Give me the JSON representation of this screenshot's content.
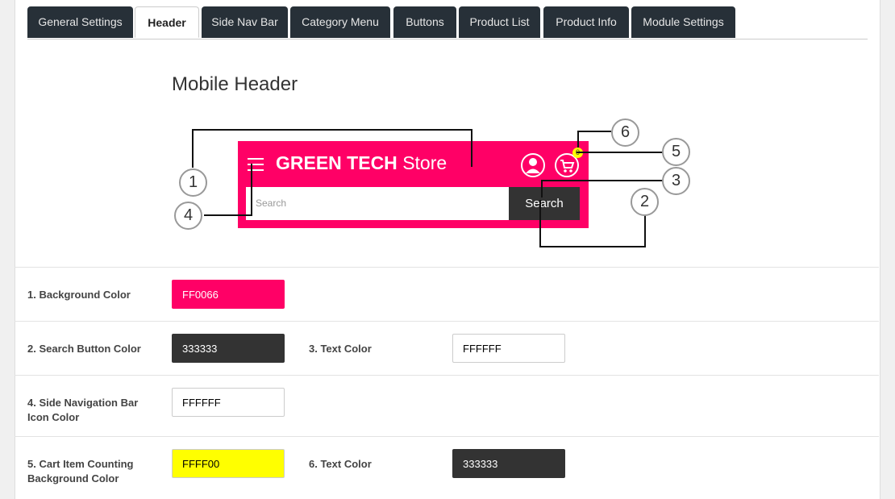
{
  "tabs": [
    {
      "label": "General Settings",
      "active": false
    },
    {
      "label": "Header",
      "active": true
    },
    {
      "label": "Side Nav Bar",
      "active": false
    },
    {
      "label": "Category Menu",
      "active": false
    },
    {
      "label": "Buttons",
      "active": false
    },
    {
      "label": "Product List",
      "active": false
    },
    {
      "label": "Product Info",
      "active": false
    },
    {
      "label": "Module Settings",
      "active": false
    }
  ],
  "section": {
    "title": "Mobile Header"
  },
  "preview": {
    "brand_bold": "GREEN TECH",
    "brand_light": "Store",
    "search_placeholder": "Search",
    "search_button": "Search",
    "cart_count": "0",
    "callouts": [
      "1",
      "2",
      "3",
      "4",
      "5",
      "6"
    ]
  },
  "fields": [
    {
      "label": "1. Background Color",
      "value": "FF0066",
      "bg": "#ff0066",
      "fg": "#ffffff"
    },
    {
      "label": "2. Search Button Color",
      "value": "333333",
      "bg": "#333333",
      "fg": "#ffffff"
    },
    {
      "label": "3. Text Color",
      "value": "FFFFFF",
      "bg": "#ffffff",
      "fg": "#000000"
    },
    {
      "label": "4. Side Navigation Bar Icon Color",
      "value": "FFFFFF",
      "bg": "#ffffff",
      "fg": "#000000"
    },
    {
      "label": "5. Cart Item Counting Background Color",
      "value": "FFFF00",
      "bg": "#ffff00",
      "fg": "#000000"
    },
    {
      "label": "6. Text Color",
      "value": "333333",
      "bg": "#333333",
      "fg": "#ffffff"
    }
  ],
  "colors": {
    "tab_bg": "#273038",
    "accent": "#ff0066"
  }
}
